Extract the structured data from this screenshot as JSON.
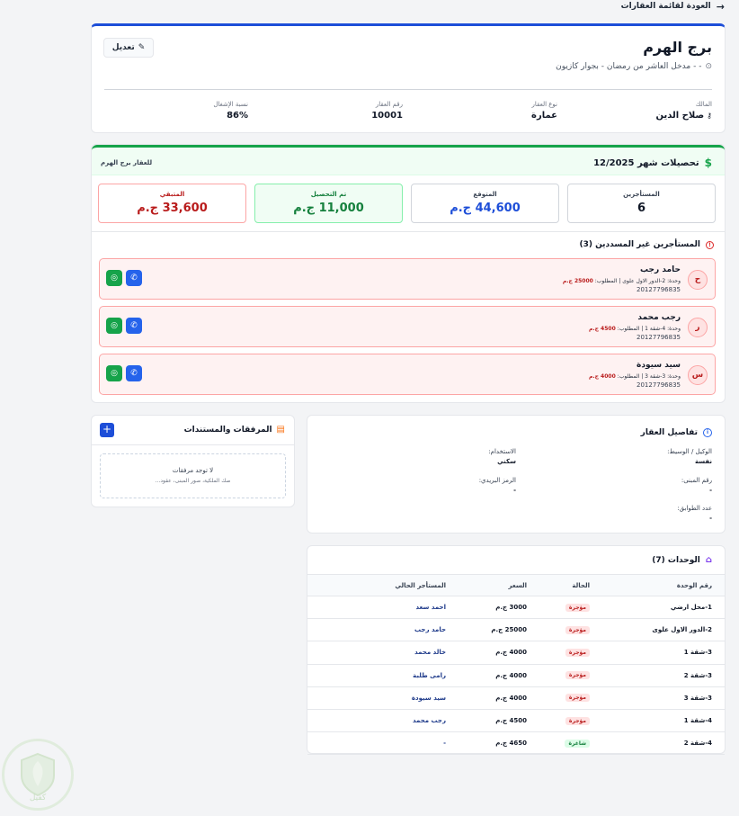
{
  "back_link": "العودة لقائمة العقارات",
  "property": {
    "name": "برج الهرم",
    "address": "- - مدخل العاشر من رمضان - بجوار كازيون",
    "edit_label": "تعديل",
    "meta": [
      {
        "label": "المالك",
        "value": "صلاح الدين"
      },
      {
        "label": "نوع العقار",
        "value": "عمارة"
      },
      {
        "label": "رقم العقار",
        "value": "10001"
      },
      {
        "label": "نسبة الإشغال",
        "value": "86%"
      }
    ]
  },
  "collections": {
    "title": "تحصيلات شهر 12/2025",
    "subtitle": "للعقار برج الهرم",
    "stats": {
      "tenants": {
        "label": "المستأجرين",
        "value": "6"
      },
      "expected": {
        "label": "المتوقع",
        "value": "44,600 ج.م"
      },
      "collected": {
        "label": "تم التحصيل",
        "value": "11,000 ج.م"
      },
      "remaining": {
        "label": "المتبقي",
        "value": "33,600 ج.م"
      }
    },
    "unpaid_title": "المستأجرين غير المسددين (3)",
    "unpaid": [
      {
        "initial": "ح",
        "name": "حامد رجب",
        "detail": "وحدة: 2-الدور الاول علوى | المطلوب:",
        "amount": "25000 ج.م",
        "phone": "20127796835"
      },
      {
        "initial": "ر",
        "name": "رجب محمد",
        "detail": "وحدة: 4-شقة 1 | المطلوب:",
        "amount": "4500 ج.م",
        "phone": "20127796835"
      },
      {
        "initial": "س",
        "name": "سيد سيودة",
        "detail": "وحدة: 3-شقة 3 | المطلوب:",
        "amount": "4000 ج.م",
        "phone": "20127796835"
      }
    ]
  },
  "attachments": {
    "title": "المرفقات والمستندات",
    "add_label": "+",
    "empty_title": "لا توجد مرفقات",
    "empty_hint": "صك الملكية، صور المبنى، عقود..."
  },
  "details": {
    "title": "تفاصيل العقار",
    "fields": {
      "agent": {
        "label": "الوكيل / الوسيط:",
        "value": "نفسة"
      },
      "usage": {
        "label": "الاستخدام:",
        "value": "سكني"
      },
      "building_no": {
        "label": "رقم المبنى:",
        "value": "-"
      },
      "postal": {
        "label": "الرمز البريدي:",
        "value": "-"
      },
      "floors": {
        "label": "عدد الطوابق:",
        "value": "-"
      }
    }
  },
  "units": {
    "title": "الوحدات (7)",
    "headers": [
      "رقم الوحدة",
      "الحالة",
      "السعر",
      "المستأجر الحالي"
    ],
    "rows": [
      {
        "unit": "1-محل ارضي",
        "status": "مؤجرة",
        "price": "3000 ج.م",
        "tenant": "احمد سعد"
      },
      {
        "unit": "2-الدور الاول علوى",
        "status": "مؤجرة",
        "price": "25000 ج.م",
        "tenant": "حامد رجب"
      },
      {
        "unit": "3-شقة 1",
        "status": "مؤجرة",
        "price": "4000 ج.م",
        "tenant": "خالد محمد"
      },
      {
        "unit": "3-شقة 2",
        "status": "مؤجرة",
        "price": "4000 ج.م",
        "tenant": "رامى طلبة"
      },
      {
        "unit": "3-شقة 3",
        "status": "مؤجرة",
        "price": "4000 ج.م",
        "tenant": "سيد سيودة"
      },
      {
        "unit": "4-شقة 1",
        "status": "مؤجرة",
        "price": "4500 ج.م",
        "tenant": "رجب محمد"
      },
      {
        "unit": "4-شقة 2",
        "status": "شاغرة",
        "price": "4650 ج.م",
        "tenant": "-"
      }
    ]
  },
  "watermark_text": "كفيل"
}
